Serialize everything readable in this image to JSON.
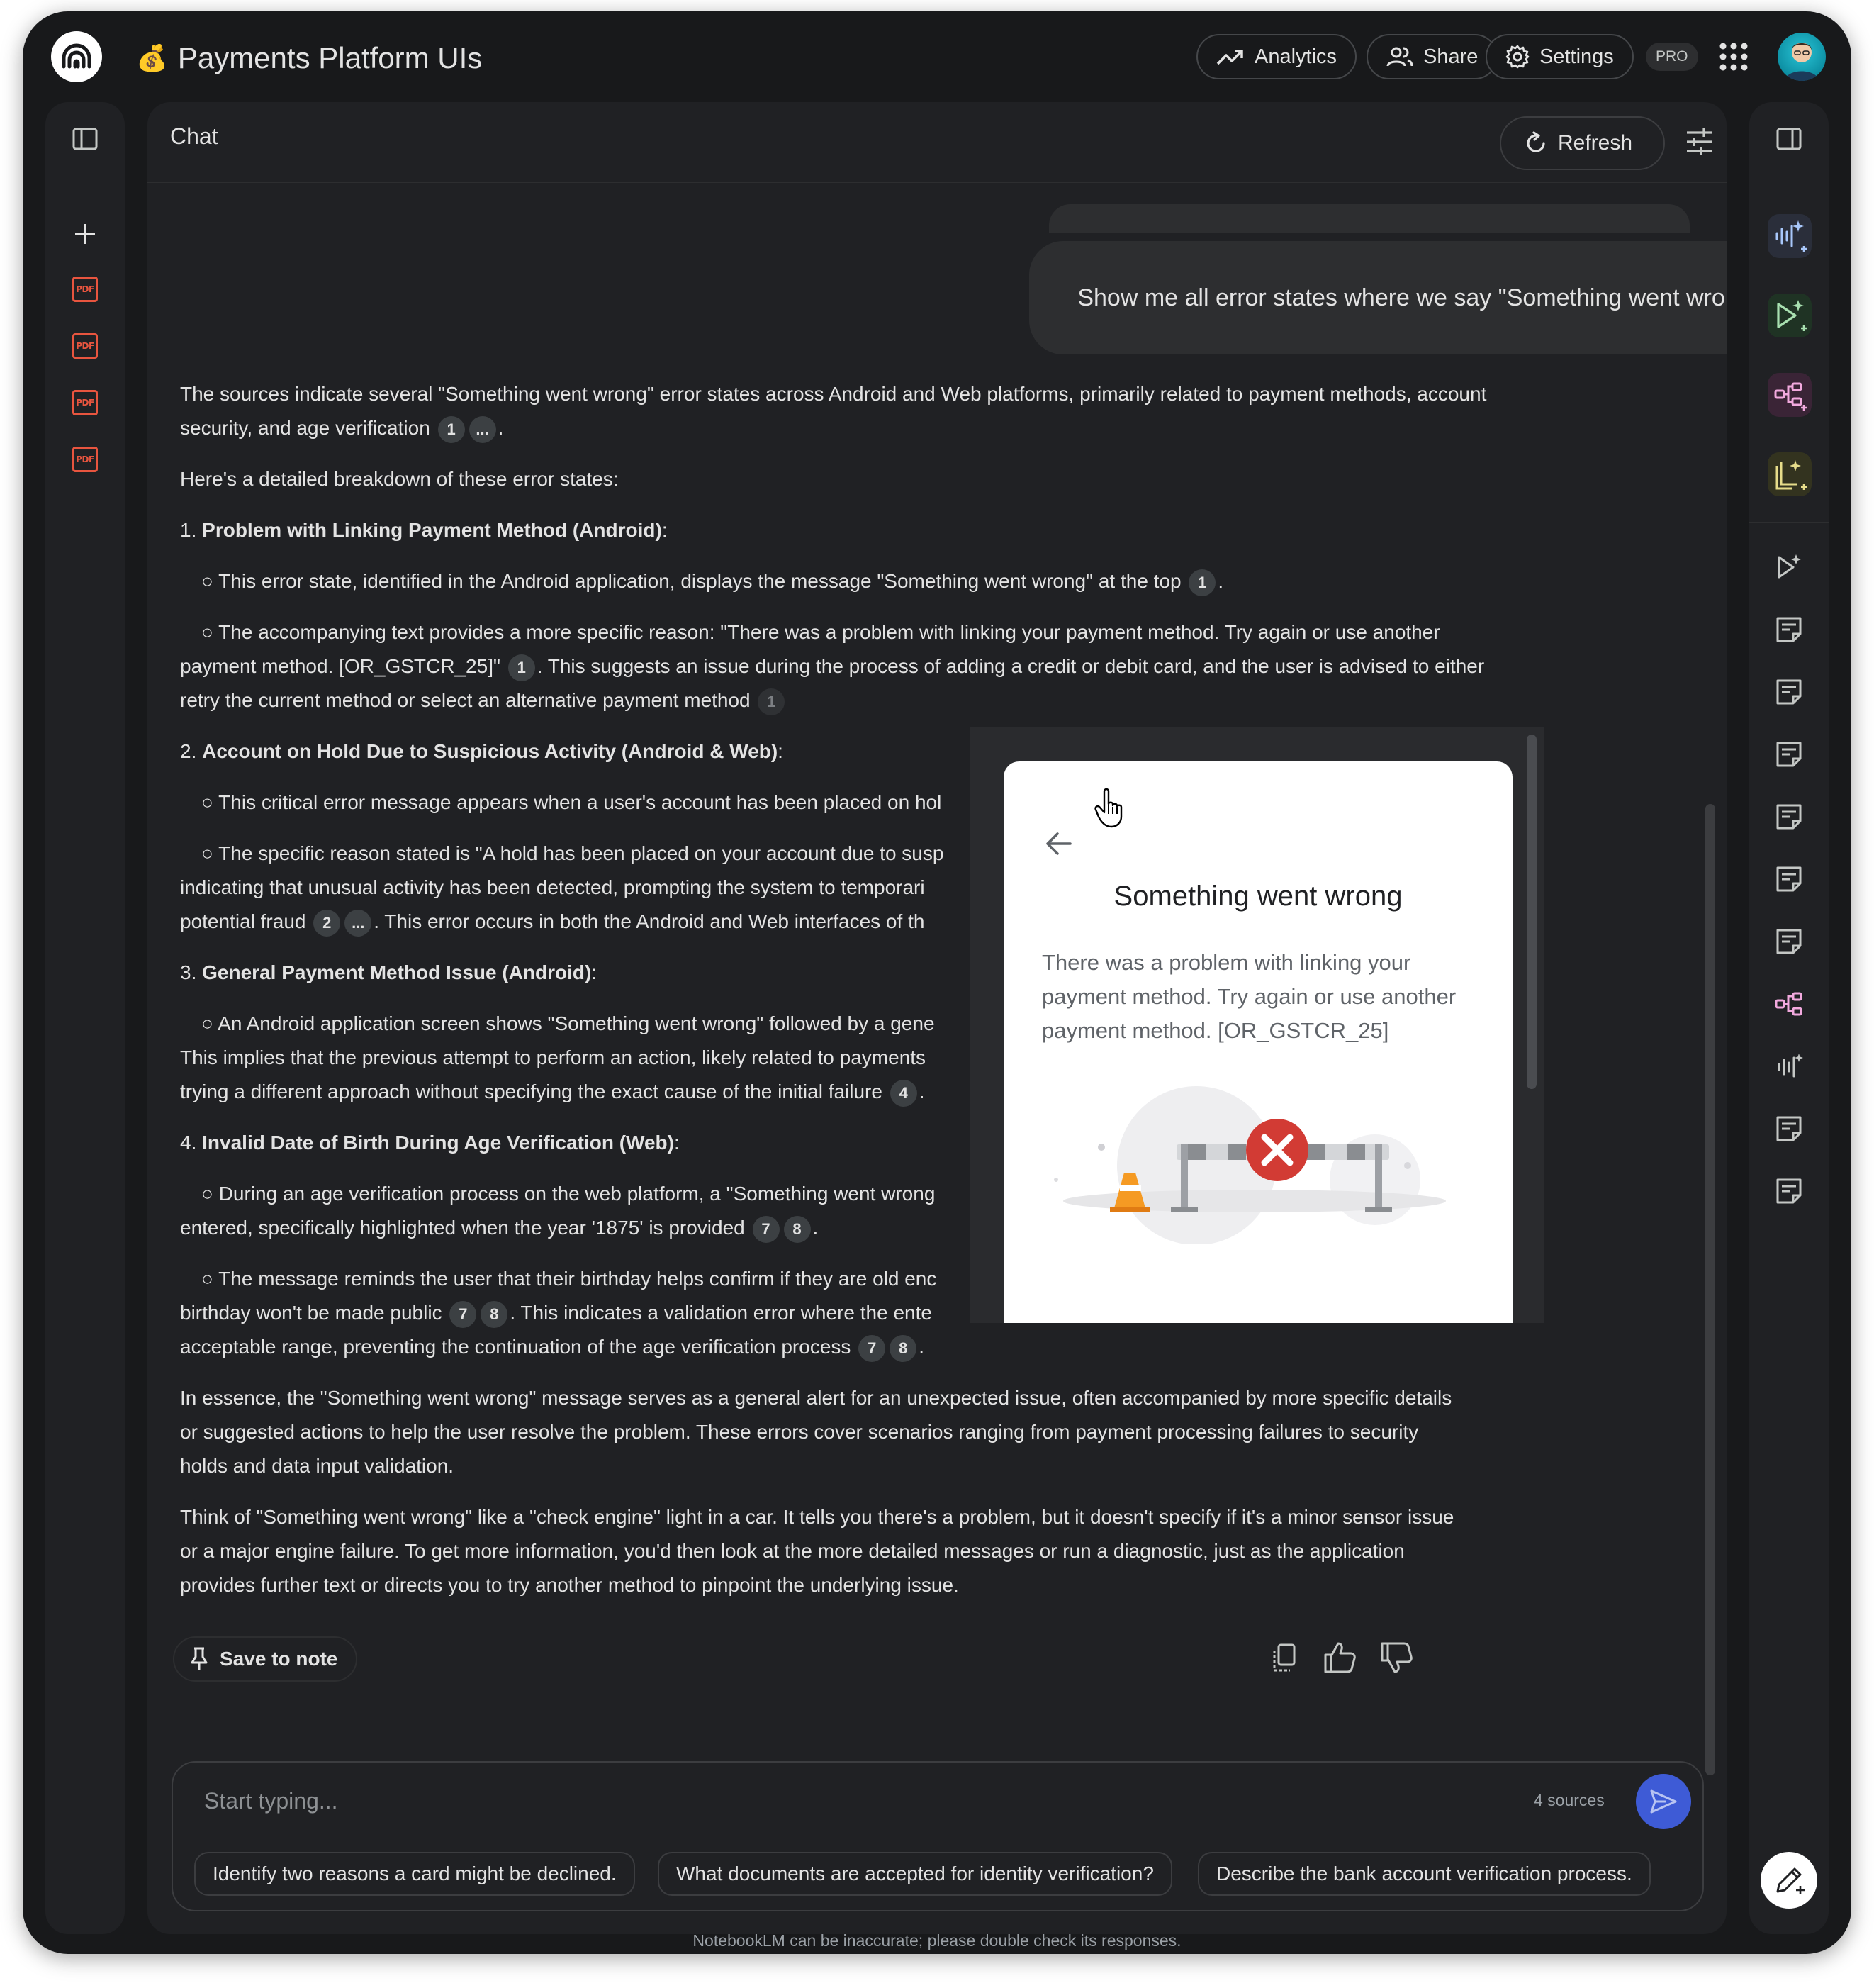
{
  "app": {
    "notebook_emoji": "💰",
    "title": "Payments Platform UIs",
    "disclaimer": "NotebookLM can be inaccurate; please double check its responses."
  },
  "header": {
    "analytics_label": "Analytics",
    "share_label": "Share",
    "settings_label": "Settings",
    "pro_badge": "PRO"
  },
  "chat": {
    "title": "Chat",
    "refresh_label": "Refresh",
    "user_message": "Show me all error states where we say \"Something went wrong\"",
    "answer": {
      "intro_1": "The sources indicate several \"Something went wrong\" error states across Android and Web platforms, primarily related to payment methods, account security, and age verification",
      "intro_2": "Here's a detailed breakdown of these error states:",
      "s1_num": "1.",
      "s1_title": "Problem with Linking Payment Method (Android)",
      "s1_b1": "○ This error state, identified in the Android application, displays the message \"Something went wrong\" at the top",
      "s1_b2a": "○ The accompanying text provides a more specific reason: \"There was a problem with linking your payment method. Try again or use another payment method. [OR_GSTCR_25]\"",
      "s1_b2b": ". This suggests an issue during the process of adding a credit or debit card, and the user is advised to either retry the current method or select an alternative payment method",
      "s2_num": "2.",
      "s2_title": "Account on Hold Due to Suspicious Activity (Android & Web)",
      "s2_b1": "○ This critical error message appears when a user's account has been placed on hol",
      "s2_b2a": "○ The specific reason stated is \"A hold has been placed on your account due to susp",
      "s2_b2b": "indicating that unusual activity has been detected, prompting the system to temporari",
      "s2_b2c": "potential fraud",
      "s2_b2d": ". This error occurs in both the Android and Web interfaces of th",
      "s3_num": "3.",
      "s3_title": "General Payment Method Issue (Android)",
      "s3_b1a": "○ An Android application screen shows \"Something went wrong\" followed by a gene",
      "s3_b1b": "This implies that the previous attempt to perform an action, likely related to payments",
      "s3_b1c": "trying a different approach without specifying the exact cause of the initial failure",
      "s4_num": "4.",
      "s4_title": "Invalid Date of Birth During Age Verification (Web)",
      "s4_b1a": "○ During an age verification process on the web platform, a \"Something went wrong",
      "s4_b1b": "entered, specifically highlighted when the year '1875' is provided",
      "s4_b2a": "○ The message reminds the user that their birthday helps confirm if they are old enc",
      "s4_b2b": "birthday won't be made public",
      "s4_b2c": ". This indicates a validation error where the ente",
      "s4_b2d": "acceptable range, preventing the continuation of the age verification process",
      "conclusion_1": "In essence, the \"Something went wrong\" message serves as a general alert for an unexpected issue, often accompanied by more specific details or suggested actions to help the user resolve the problem. These errors cover scenarios ranging from payment processing failures to security holds and data input validation.",
      "conclusion_2": "Think of \"Something went wrong\" like a \"check engine\" light in a car. It tells you there's a problem, but it doesn't specify if it's a minor sensor issue or a major engine failure. To get more information, you'd then look at the more detailed messages or run a diagnostic, just as the application provides further text or directs you to try another method to pinpoint the underlying issue."
    },
    "citations": {
      "c1": "1",
      "more": "...",
      "c2": "2",
      "c4": "4",
      "c7": "7",
      "c8": "8"
    },
    "save_to_note_label": "Save to note"
  },
  "citation_preview": {
    "title": "Something went wrong",
    "body": "There was a problem with linking your payment method. Try again or use another payment method. [OR_GSTCR_25]"
  },
  "composer": {
    "placeholder": "Start typing...",
    "sources_count": "4 sources",
    "suggestions": [
      "Identify two reasons a card might be declined.",
      "What documents are accepted for identity verification?",
      "Describe the bank account verification process."
    ]
  },
  "sources_panel": {
    "items": [
      "PDF",
      "PDF",
      "PDF",
      "PDF"
    ]
  },
  "colors": {
    "pdf_icon": "#e8553f",
    "send_button": "#3e5bd6",
    "audio_tile": "#2a2e3a",
    "video_tile": "#1f3324",
    "mindmap_tile": "#3a2436",
    "report_tile": "#33331f"
  }
}
